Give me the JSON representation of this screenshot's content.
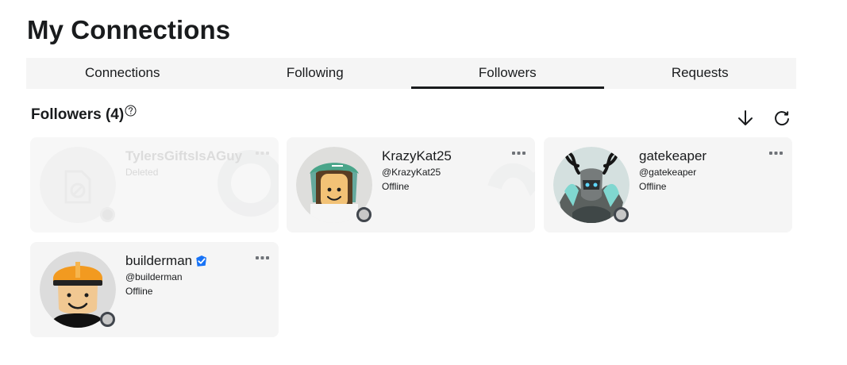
{
  "page": {
    "title": "My Connections"
  },
  "tabs": [
    {
      "label": "Connections"
    },
    {
      "label": "Following"
    },
    {
      "label": "Followers"
    },
    {
      "label": "Requests"
    }
  ],
  "section": {
    "title": "Followers (4)",
    "help_icon": "question-circle-icon",
    "actions": [
      "sort-down-icon",
      "refresh-icon"
    ]
  },
  "cards": [
    {
      "display_name": "TylersGiftsIsAGuy",
      "status": "Deleted",
      "presence_color": "#e6e6e6"
    },
    {
      "display_name": "KrazyKat25",
      "username": "@KrazyKat25",
      "presence": "Offline",
      "presence_color": "#c7c7c7"
    },
    {
      "display_name": "gatekeaper",
      "username": "@gatekeaper",
      "presence": "Offline",
      "presence_color": "#c7c7c7"
    },
    {
      "display_name": "builderman",
      "username": "@builderman",
      "presence": "Offline",
      "presence_color": "#c7c7c7",
      "verified_icon": "verified-badge-icon"
    }
  ],
  "colors": {
    "active_tab_underline": "#191b1d",
    "card_background": "#f5f5f5",
    "verified_blue": "#1873f6"
  }
}
